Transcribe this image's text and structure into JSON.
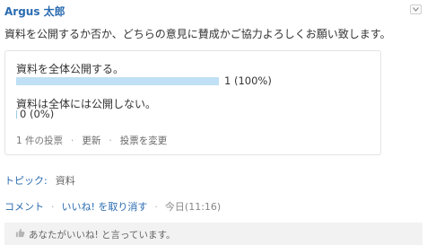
{
  "post": {
    "author": "Argus 太郎",
    "question": "資料を公開するか否か、どちらの意見に賛成かご協力よろしくお願い致します。"
  },
  "poll": {
    "options": [
      {
        "label": "資料を全体公開する。",
        "count_text": "1 (100%)",
        "percent": 100
      },
      {
        "label": "資料は全体には公開しない。",
        "count_text": "0 (0%)",
        "percent": 0
      }
    ],
    "footer": {
      "votes": "1 件の投票",
      "refresh": "更新",
      "change_vote": "投票を変更"
    }
  },
  "topic": {
    "label": "トピック:",
    "value": "資料"
  },
  "actions": {
    "comment": "コメント",
    "unlike": "いいね! を取り消す",
    "timestamp": "今日(11:16)"
  },
  "likes": {
    "text": "あなたがいいね! と言っています。"
  },
  "icons": {
    "menu": "chevron-down-icon",
    "like": "thumbs-up-icon"
  },
  "colors": {
    "link": "#2a6bb0",
    "bar": "#bfe0f5"
  }
}
